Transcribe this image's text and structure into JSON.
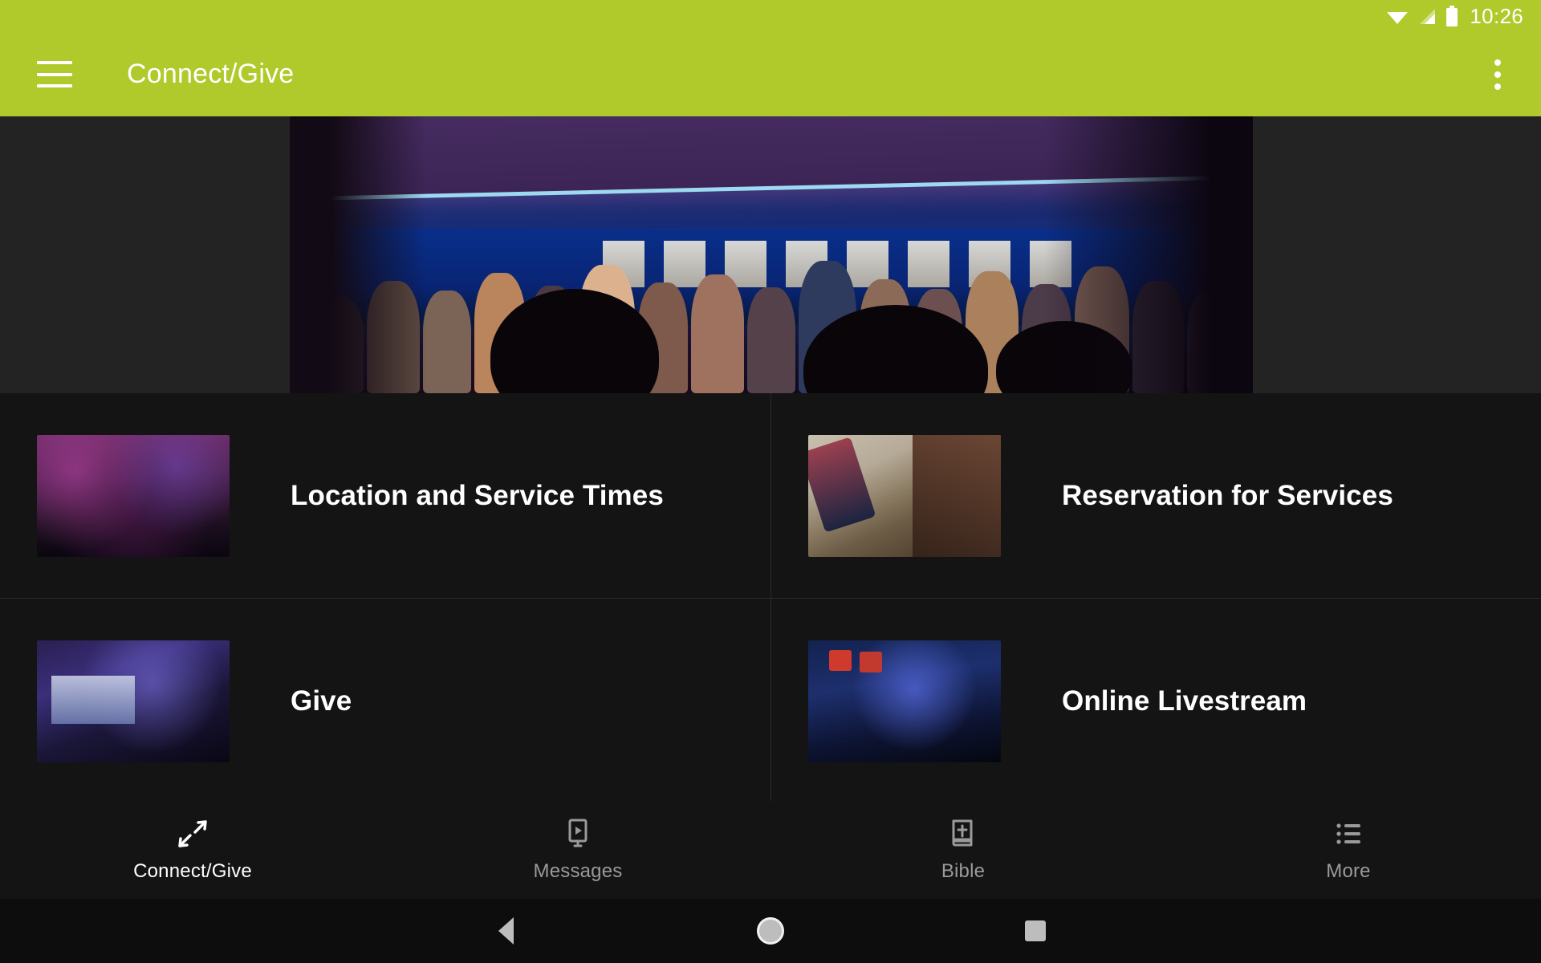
{
  "status_bar": {
    "time": "10:26",
    "icons": [
      "wifi-icon",
      "cellular-signal-icon",
      "battery-icon"
    ]
  },
  "app_bar": {
    "title": "Connect/Give",
    "menu_icon": "hamburger-menu-icon",
    "overflow_icon": "overflow-menu-icon",
    "background_color": "#B0C92B",
    "title_color": "#FFFFFF"
  },
  "hero": {
    "alt": "Worship band and choir performing on a blue-lit stage with a large projection screen",
    "background_color": "#232323"
  },
  "cards": [
    {
      "title": "Location and Service Times",
      "thumbnail": "congregation-worship-thumbnail"
    },
    {
      "title": "Reservation for Services",
      "thumbnail": "hand-holding-phone-thumbnail"
    },
    {
      "title": "Give",
      "thumbnail": "broadcast-studio-thumbnail"
    },
    {
      "title": "Online Livestream",
      "thumbnail": "livestream-stage-thumbnail"
    }
  ],
  "tab_bar": {
    "tabs": [
      {
        "label": "Connect/Give",
        "icon": "connect-arrows-icon",
        "active": true
      },
      {
        "label": "Messages",
        "icon": "video-message-icon",
        "active": false
      },
      {
        "label": "Bible",
        "icon": "bible-book-icon",
        "active": false
      },
      {
        "label": "More",
        "icon": "list-more-icon",
        "active": false
      }
    ],
    "active_color": "#FFFFFF",
    "inactive_color": "#9A9A9A"
  },
  "system_nav": {
    "back": "back-button",
    "home": "home-button",
    "recents": "recents-button"
  },
  "theme": {
    "accent": "#B0C92B",
    "surface": "#141414",
    "hero_surface": "#232323",
    "divider": "#2B2B2B"
  }
}
